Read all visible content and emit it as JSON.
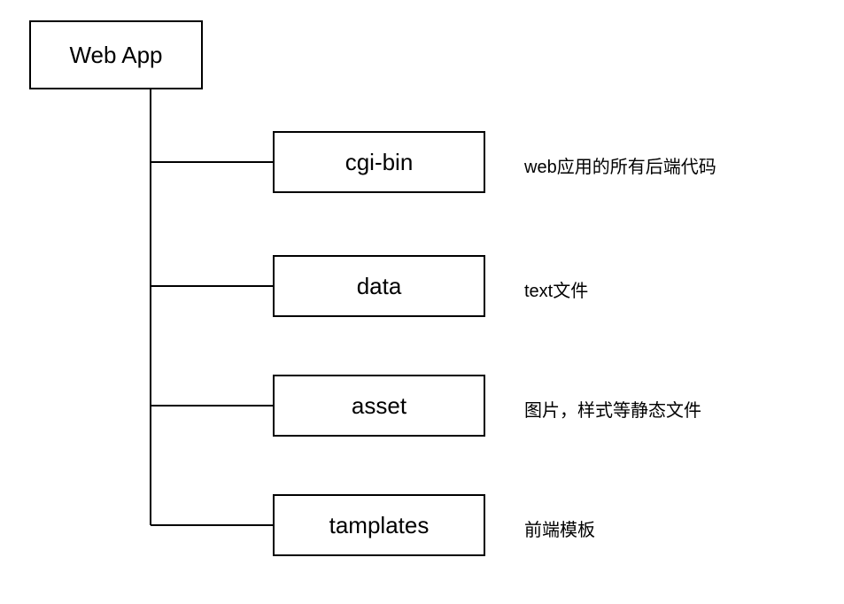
{
  "root": {
    "label": "Web App"
  },
  "children": [
    {
      "label": "cgi-bin",
      "description": "web应用的所有后端代码"
    },
    {
      "label": "data",
      "description": "text文件"
    },
    {
      "label": "asset",
      "description": "图片，样式等静态文件"
    },
    {
      "label": "tamplates",
      "description": "前端模板"
    }
  ]
}
